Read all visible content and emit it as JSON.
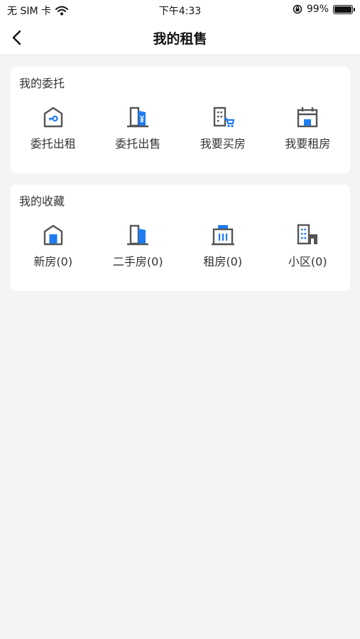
{
  "status_bar": {
    "carrier": "无 SIM 卡",
    "time": "下午4:33",
    "battery": "99%",
    "battery_level": 0.99
  },
  "nav": {
    "title": "我的租售",
    "back_icon": "chevron-left-icon"
  },
  "entrust": {
    "title": "我的委托",
    "items": [
      {
        "label": "委托出租",
        "icon": "house-key-icon"
      },
      {
        "label": "委托出售",
        "icon": "building-yuan-icon"
      },
      {
        "label": "我要买房",
        "icon": "building-cart-icon"
      },
      {
        "label": "我要租房",
        "icon": "calendar-house-icon"
      }
    ]
  },
  "favorites": {
    "title": "我的收藏",
    "items": [
      {
        "label": "新房(0)",
        "icon": "new-house-icon"
      },
      {
        "label": "二手房(0)",
        "icon": "second-hand-house-icon"
      },
      {
        "label": "租房(0)",
        "icon": "rental-icon"
      },
      {
        "label": "小区(0)",
        "icon": "community-icon"
      }
    ]
  },
  "colors": {
    "accent": "#1e7cf2",
    "icon_gray": "#555555",
    "background": "#f4f4f4"
  }
}
